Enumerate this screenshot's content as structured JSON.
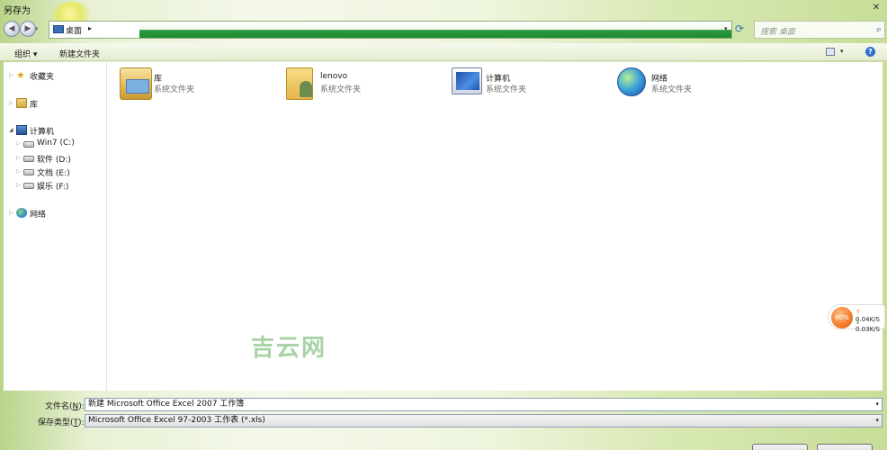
{
  "window": {
    "title": "另存为",
    "close_glyph": "✕"
  },
  "address": {
    "location": "桌面",
    "arrow": "▸",
    "back_glyph": "◀",
    "forward_glyph": "▶",
    "dropdown_glyph": "▾"
  },
  "search": {
    "placeholder": "搜索 桌面"
  },
  "toolbar": {
    "organize": "组织 ▾",
    "new_folder": "新建文件夹",
    "help": "?"
  },
  "sidebar": {
    "items": [
      {
        "label": "收藏夹",
        "icon": "star-icon"
      },
      {
        "label": "库",
        "icon": "library-icon"
      },
      {
        "label": "计算机",
        "icon": "computer-icon"
      },
      {
        "label": "Win7 (C:)",
        "icon": "drive-icon"
      },
      {
        "label": "软件 (D:)",
        "icon": "drive-icon"
      },
      {
        "label": "文档 (E:)",
        "icon": "drive-icon"
      },
      {
        "label": "娱乐 (F:)",
        "icon": "drive-icon"
      },
      {
        "label": "网络",
        "icon": "network-icon"
      }
    ]
  },
  "content": {
    "items": [
      {
        "name": "库",
        "subtitle": "系统文件夹",
        "icon": "library-icon"
      },
      {
        "name": "lenovo",
        "subtitle": "系统文件夹",
        "icon": "user-folder-icon"
      },
      {
        "name": "计算机",
        "subtitle": "系统文件夹",
        "icon": "computer-icon"
      },
      {
        "name": "网络",
        "subtitle": "系统文件夹",
        "icon": "network-icon"
      }
    ]
  },
  "speed_widget": {
    "percent": "80%",
    "up": "0.04K/S",
    "down": "0.03K/S",
    "up_arrow": "↑",
    "down_arrow": "↓"
  },
  "watermark": "吉云网",
  "form": {
    "filename_label": "文件名(",
    "filename_key": "N",
    "filename_suffix": "):",
    "filename_value": "新建 Microsoft Office Excel 2007 工作簿",
    "filetype_label": "保存类型(",
    "filetype_key": "T",
    "filetype_suffix": "):",
    "filetype_value": "Microsoft Office Excel 97-2003 工作表 (*.xls)"
  },
  "colors": {
    "accent_green": "#1e8a33",
    "frame_green": "#c8dd98"
  }
}
